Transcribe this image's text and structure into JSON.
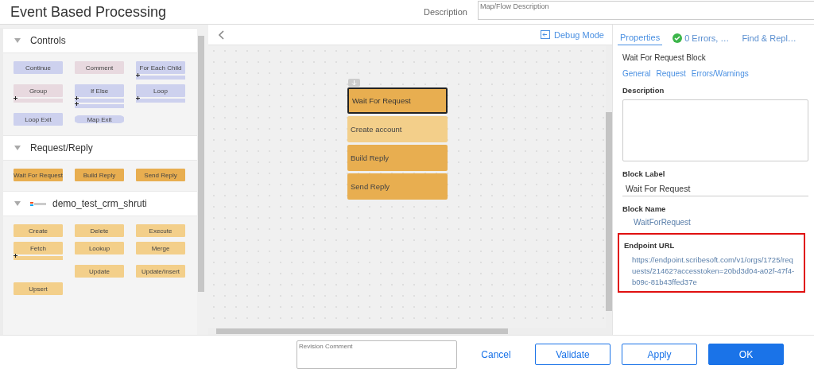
{
  "header": {
    "title": "Event Based Processing",
    "description_label": "Description",
    "description_placeholder": "Map/Flow Description"
  },
  "palette": {
    "sections": [
      {
        "title": "Controls",
        "expanded": true,
        "logo": false,
        "blocks": [
          {
            "label": "Continue",
            "kind": "statement",
            "color": "#cdd1ee"
          },
          {
            "label": "Comment",
            "kind": "statement",
            "color": "#e8d9df"
          },
          {
            "label": "For Each Child",
            "kind": "container",
            "color": "#cdd1ee"
          },
          {
            "label": "Group",
            "kind": "container",
            "color": "#e8d9df"
          },
          {
            "label": "If Else",
            "kind": "if-else",
            "color": "#cdd1ee"
          },
          {
            "label": "Loop",
            "kind": "container",
            "color": "#cdd1ee"
          },
          {
            "label": "Loop Exit",
            "kind": "statement",
            "color": "#cdd1ee"
          },
          {
            "label": "Map Exit",
            "kind": "terminal",
            "color": "#cdd1ee"
          }
        ]
      },
      {
        "title": "Request/Reply",
        "expanded": true,
        "logo": false,
        "blocks": [
          {
            "label": "Wait For Request",
            "kind": "statement",
            "color": "#e8ae50"
          },
          {
            "label": "Build Reply",
            "kind": "statement",
            "color": "#e8ae50"
          },
          {
            "label": "Send Reply",
            "kind": "statement",
            "color": "#e8ae50"
          }
        ]
      },
      {
        "title": "demo_test_crm_shruti",
        "expanded": true,
        "logo": true,
        "blocks": [
          {
            "label": "Create",
            "kind": "statement",
            "color": "#f3cf8a"
          },
          {
            "label": "Delete",
            "kind": "statement",
            "color": "#f3cf8a"
          },
          {
            "label": "Execute",
            "kind": "statement",
            "color": "#f3cf8a"
          },
          {
            "label": "Fetch",
            "kind": "container",
            "color": "#f3cf8a"
          },
          {
            "label": "Lookup",
            "kind": "statement",
            "color": "#f3cf8a"
          },
          {
            "label": "Merge",
            "kind": "statement",
            "color": "#f3cf8a"
          },
          {
            "kind": "spacer"
          },
          {
            "label": "Update",
            "kind": "statement",
            "color": "#f3cf8a"
          },
          {
            "label": "Update/Insert",
            "kind": "statement",
            "color": "#f3cf8a"
          },
          {
            "label": "Upsert",
            "kind": "statement",
            "color": "#f3cf8a"
          }
        ]
      }
    ]
  },
  "canvas": {
    "debug_label": "Debug Mode",
    "blocks": [
      {
        "label": "Wait For Request",
        "selected": true,
        "color": "#e8ae50"
      },
      {
        "label": "Create account",
        "selected": false,
        "color": "#f3cf8a"
      },
      {
        "label": "Build Reply",
        "selected": false,
        "color": "#e8ae50"
      },
      {
        "label": "Send Reply",
        "selected": false,
        "color": "#e8ae50"
      }
    ]
  },
  "properties": {
    "tabs": [
      {
        "label": "Properties",
        "selected": true,
        "status_icon": false
      },
      {
        "label": "0 Errors, …",
        "selected": false,
        "status_icon": true
      },
      {
        "label": "Find & Repl…",
        "selected": false,
        "status_icon": false
      }
    ],
    "block_title": "Wait For Request Block",
    "links": [
      "General",
      "Request",
      "Errors/Warnings"
    ],
    "description_label": "Description",
    "block_label_label": "Block Label",
    "block_label_value": "Wait For Request",
    "block_name_label": "Block Name",
    "block_name_value": "WaitForRequest",
    "endpoint": {
      "label": "Endpoint URL",
      "value": "https://endpoint.scribesoft.com/v1/orgs/1725/requests/21462?accesstoken=20bd3d04-a02f-47f4-b09c-81b43ffed37e",
      "highlighted": true
    }
  },
  "footer": {
    "revision_placeholder": "Revision Comment",
    "buttons": [
      {
        "label": "Cancel",
        "kind": "link"
      },
      {
        "label": "Validate",
        "kind": "outline"
      },
      {
        "label": "Apply",
        "kind": "outline"
      },
      {
        "label": "OK",
        "kind": "primary"
      }
    ]
  }
}
